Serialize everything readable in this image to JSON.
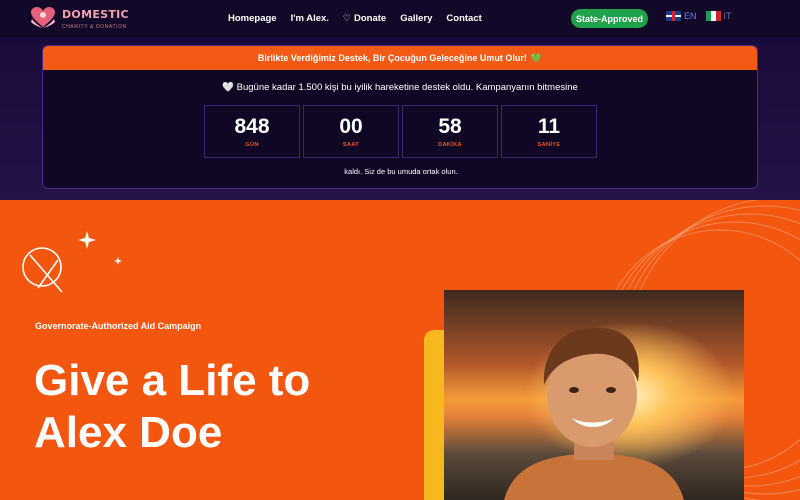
{
  "nav": {
    "logo_title": "DOMESTIC",
    "logo_subtitle": "CHARITY & DONATION",
    "menu": [
      {
        "label": "Homepage"
      },
      {
        "label": "I'm Alex."
      },
      {
        "label": "Donate",
        "icon": "heart-outline-icon"
      },
      {
        "label": "Gallery"
      },
      {
        "label": "Contact"
      }
    ],
    "state_badge": "State-Approved",
    "languages": [
      {
        "code": "EN",
        "flag": "uk-flag-icon",
        "active": true
      },
      {
        "code": "IT",
        "flag": "italy-flag-icon",
        "active": false
      }
    ]
  },
  "banner": {
    "strip_text": "Birlikte Verdiğimiz Destek, Bir Çocuğun Geleceğine Umut Olur!",
    "strip_icon": "💚",
    "message_icon": "🤍",
    "message": "Bugüne kadar 1.500 kişi bu iyilik hareketine destek oldu. Kampanyanın bitmesine",
    "countdown": [
      {
        "value": "848",
        "label": "GÜN"
      },
      {
        "value": "00",
        "label": "SAAT"
      },
      {
        "value": "58",
        "label": "DAKİKA"
      },
      {
        "value": "11",
        "label": "SANİYE"
      }
    ],
    "footer": "kaldı. Siz de bu umuda ortak olun."
  },
  "hero": {
    "subtitle": "Governorate-Authorized Aid Campaign",
    "title_line1": "Give a Life to",
    "title_line2": "Alex Doe",
    "photo": "portrait-boy-sunset-image"
  },
  "colors": {
    "nav_bg": "#120827",
    "accent_orange": "#f2560f",
    "badge_green": "#1fa34a",
    "yellow": "#f6b81c",
    "countdown_label": "#ef5a1f"
  }
}
